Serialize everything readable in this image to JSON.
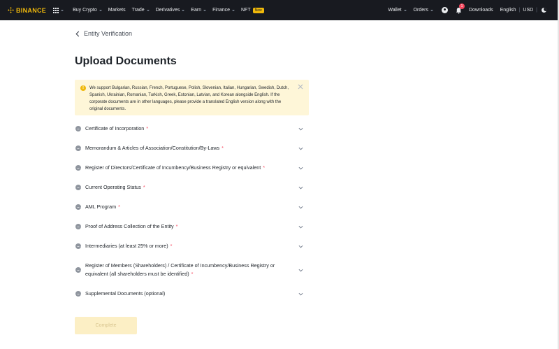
{
  "navbar": {
    "brand": "BINANCE",
    "items": [
      {
        "label": "Buy Crypto",
        "caret": true
      },
      {
        "label": "Markets",
        "caret": false
      },
      {
        "label": "Trade",
        "caret": true
      },
      {
        "label": "Derivatives",
        "caret": true
      },
      {
        "label": "Earn",
        "caret": true
      },
      {
        "label": "Finance",
        "caret": true
      },
      {
        "label": "NFT",
        "caret": false,
        "badge": "New"
      }
    ],
    "wallet_label": "Wallet",
    "orders_label": "Orders",
    "notification_count": "1",
    "downloads_label": "Downloads",
    "language_label": "English",
    "currency_label": "USD",
    "separator": "|"
  },
  "page": {
    "back_label": "Entity Verification",
    "title": "Upload Documents"
  },
  "notice": {
    "text": "We support Bulgarian, Russian, French, Portuguese, Polish, Slovenian, Italian, Hungarian, Swedish, Dutch, Spanish, Ukrainian, Romanian, Turkish, Greek, Estonian, Latvian, and Korean alongside English. If the corporate documents are in other languages, please provide a translated English version along with the original documents.",
    "icon": "warning-icon"
  },
  "documents": [
    {
      "label": "Certificate of Incorporation",
      "required": true
    },
    {
      "label": "Memorandum & Articles of Association/Constitution/By-Laws",
      "required": true
    },
    {
      "label": "Register of Directors/Certificate of Incumbency/Business Registry or equivalent",
      "required": true
    },
    {
      "label": "Current Operating Status",
      "required": true
    },
    {
      "label": "AML Program",
      "required": true
    },
    {
      "label": "Proof of Address Collection of the Entity",
      "required": true
    },
    {
      "label": "Intermediaries (at least 25% or more)",
      "required": true
    },
    {
      "label": "Register of Members (Shareholders) / Certificate of Incumbency/Business Registry or equivalent (all shareholders must be identified)",
      "required": true
    },
    {
      "label": "Supplemental Documents (optional)",
      "required": false
    }
  ],
  "required_mark": "*",
  "complete_label": "Complete",
  "colors": {
    "navbar_bg": "#181a20",
    "brand": "#f0b90b",
    "notice_bg": "#fef6d8",
    "required": "#f6465d",
    "button_disabled_bg": "#fcefc5"
  }
}
